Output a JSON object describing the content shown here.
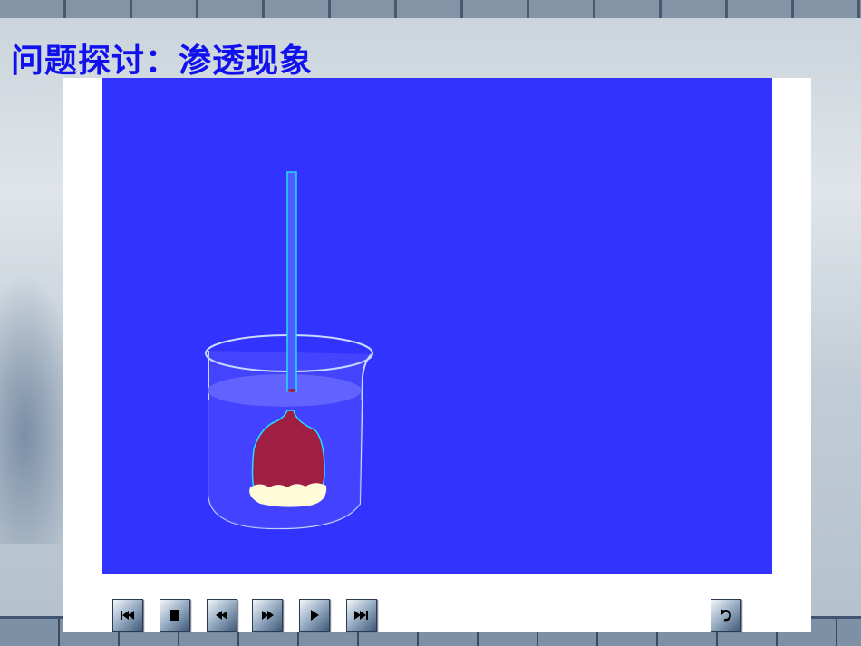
{
  "title": "问题探讨：渗透现象",
  "animation": {
    "description_colors": {
      "stage": "#3333ff",
      "solution": "#a01e44",
      "membrane": "#fffbd8",
      "tube": "#22ddff"
    }
  },
  "controls": [
    {
      "name": "rewind-to-start-button",
      "icon": "skip-back-icon"
    },
    {
      "name": "stop-button",
      "icon": "stop-icon"
    },
    {
      "name": "rewind-button",
      "icon": "rewind-icon"
    },
    {
      "name": "fast-forward-button",
      "icon": "fast-forward-icon"
    },
    {
      "name": "play-button",
      "icon": "play-icon"
    },
    {
      "name": "skip-to-end-button",
      "icon": "skip-forward-icon"
    },
    {
      "name": "replay-button",
      "icon": "replay-icon"
    }
  ]
}
